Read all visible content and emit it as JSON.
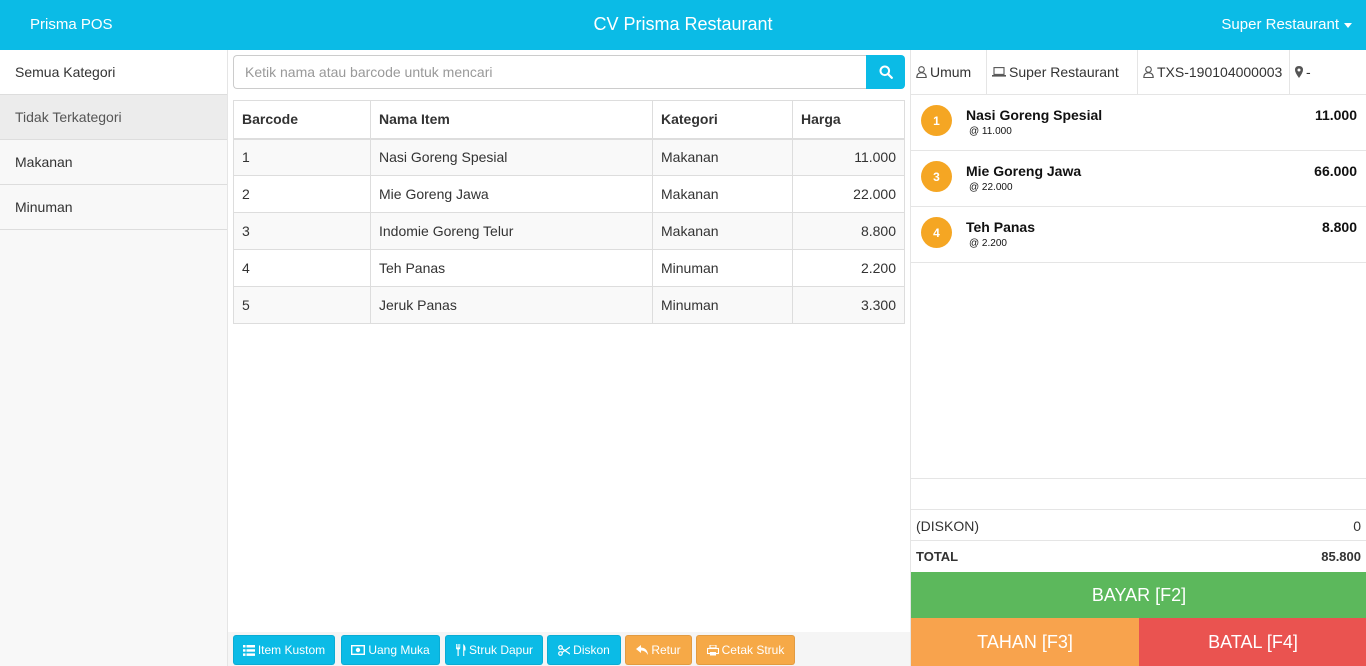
{
  "header": {
    "brand": "Prisma POS",
    "title": "CV Prisma Restaurant",
    "user": "Super Restaurant"
  },
  "sidebar": {
    "items": [
      {
        "label": "Semua Kategori"
      },
      {
        "label": "Tidak Terkategori"
      },
      {
        "label": "Makanan"
      },
      {
        "label": "Minuman"
      }
    ],
    "active_index": 1
  },
  "search": {
    "placeholder": "Ketik nama atau barcode untuk mencari",
    "value": ""
  },
  "table": {
    "headers": {
      "barcode": "Barcode",
      "name": "Nama Item",
      "category": "Kategori",
      "price": "Harga"
    },
    "rows": [
      {
        "barcode": "1",
        "name": "Nasi Goreng Spesial",
        "category": "Makanan",
        "price": "11.000"
      },
      {
        "barcode": "2",
        "name": "Mie Goreng Jawa",
        "category": "Makanan",
        "price": "22.000"
      },
      {
        "barcode": "3",
        "name": "Indomie Goreng Telur",
        "category": "Makanan",
        "price": "8.800"
      },
      {
        "barcode": "4",
        "name": "Teh Panas",
        "category": "Minuman",
        "price": "2.200"
      },
      {
        "barcode": "5",
        "name": "Jeruk Panas",
        "category": "Minuman",
        "price": "3.300"
      }
    ]
  },
  "actions": {
    "item_kustom": "Item Kustom",
    "uang_muka": "Uang Muka",
    "struk_dapur": "Struk Dapur",
    "diskon": "Diskon",
    "retur": "Retur",
    "cetak_struk": "Cetak Struk"
  },
  "transaction": {
    "customer": "Umum",
    "terminal": "Super Restaurant",
    "code": "TXS-190104000003",
    "table": "-"
  },
  "cart": {
    "items": [
      {
        "qty": "1",
        "name": "Nasi Goreng Spesial",
        "unit": "@ 11.000",
        "total": "11.000"
      },
      {
        "qty": "3",
        "name": "Mie Goreng Jawa",
        "unit": "@ 22.000",
        "total": "66.000"
      },
      {
        "qty": "4",
        "name": "Teh Panas",
        "unit": "@ 2.200",
        "total": "8.800"
      }
    ]
  },
  "summary": {
    "discount_label": "(DISKON)",
    "discount_value": "0",
    "total_label": "TOTAL",
    "total_value": "85.800"
  },
  "buttons": {
    "bayar": "BAYAR [F2]",
    "tahan": "TAHAN [F3]",
    "batal": "BATAL [F4]"
  },
  "colors": {
    "primary": "#0bbbe6",
    "success": "#5cb85c",
    "warning": "#f8a34d",
    "danger": "#ea5350",
    "badge": "#f5a623"
  },
  "icons": {
    "search": "search-icon",
    "list": "list-icon",
    "money": "money-icon",
    "cutlery": "cutlery-icon",
    "scissors": "scissors-icon",
    "reply": "reply-icon",
    "print": "print-icon",
    "user": "user-icon",
    "laptop": "laptop-icon",
    "map_marker": "map-marker-icon"
  }
}
